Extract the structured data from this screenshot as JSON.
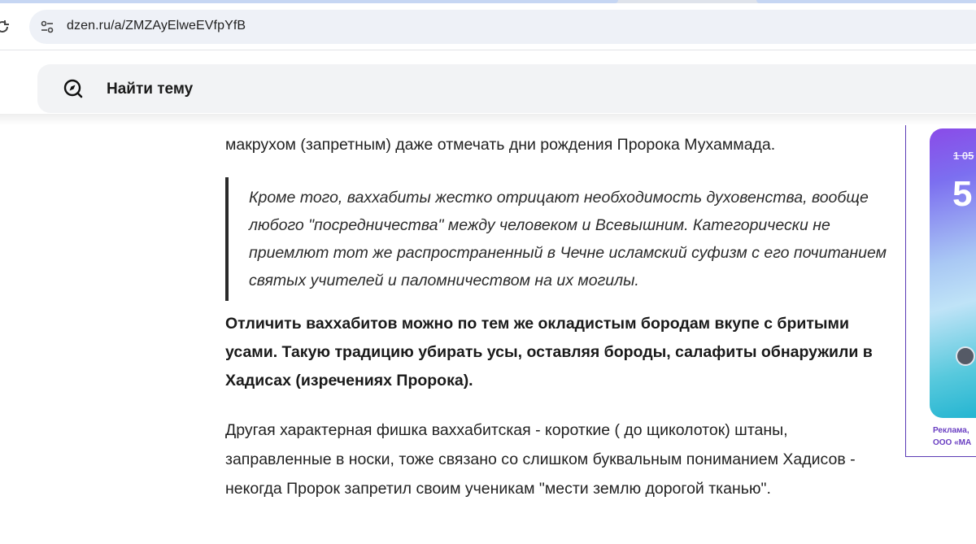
{
  "browser": {
    "url": "dzen.ru/a/ZMZAyElweEVfpYfB"
  },
  "search": {
    "label": "Найти тему"
  },
  "article": {
    "paragraph_top": "макрухом (запретным) даже отмечать дни рождения Пророка Мухаммада.",
    "quote": "Кроме того, ваххабиты жестко отрицают необходимость духовенства, вообще любого \"посредничества\" между человеком и Всевышним. Категорически не приемлют тот же распространенный в Чечне исламский суфизм с его почитанием святых учителей и паломничеством на их могилы.",
    "paragraph_bold": "Отличить ваххабитов можно по тем же окладистым бородам вкупе с бритыми усами. Такую традицию убирать усы, оставляя бороды, салафиты обнаружили в Хадисах (изречениях Пророка).",
    "paragraph_bottom": "Другая характерная фишка ваххабитская - короткие ( до щиколоток) штаны, заправленные в носки, тоже связано со слишком буквальным пониманием Хадисов - некогда Пророк запретил своим ученикам \"мести землю дорогой тканью\"."
  },
  "ad": {
    "old_price": "1 05",
    "big_text": "5",
    "caption_line1": "Реклама,",
    "caption_line2": "ООО «МА"
  },
  "colors": {
    "quote_border": "#2a2a2a",
    "ad_border": "#5b3bb5",
    "ad_caption": "#6a3fc2",
    "omnibox_bg": "#eef1f7",
    "search_bg": "#f2f3f5"
  },
  "icons": {
    "reload": "reload-icon",
    "site_info": "site-info-icon",
    "search": "search-icon"
  }
}
